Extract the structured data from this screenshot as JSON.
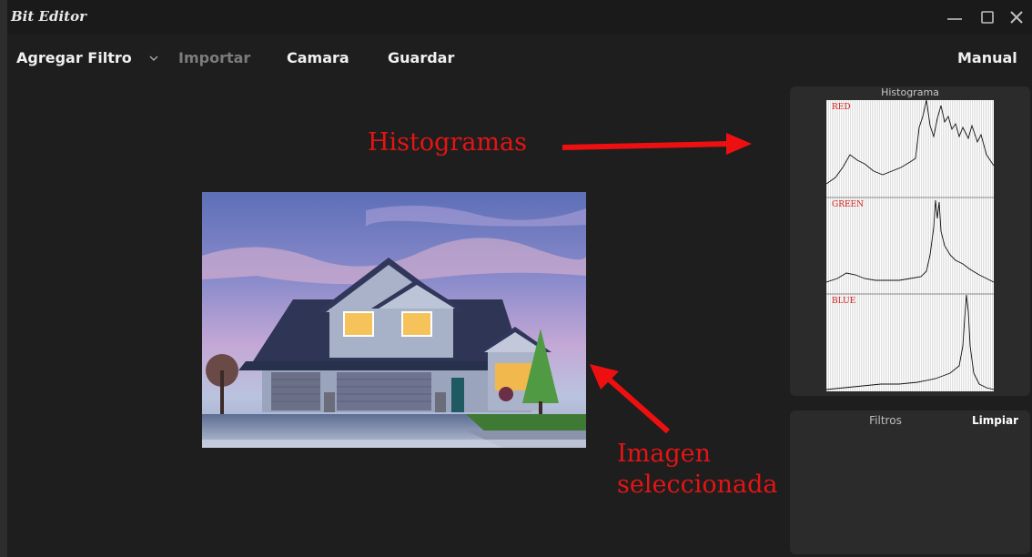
{
  "window": {
    "title": "Bit Editor",
    "controls": [
      "minimize-icon",
      "maximize-icon",
      "close-icon"
    ]
  },
  "menu": {
    "add_filter": "Agregar Filtro",
    "import": "Importar",
    "camera": "Camara",
    "save": "Guardar",
    "manual": "Manual"
  },
  "annotations": {
    "histograms": "Histogramas",
    "selected_image_line1": "Imagen",
    "selected_image_line2": "seleccionada"
  },
  "histogram_panel": {
    "title": "Histograma",
    "channels": [
      "RED",
      "GREEN",
      "BLUE"
    ]
  },
  "filters_panel": {
    "title": "Filtros",
    "clear_label": "Limpiar"
  },
  "colors": {
    "background": "#1e1e1e",
    "panel": "#2b2b2b",
    "annotation": "#e51414",
    "channel_label": "#d42020"
  }
}
